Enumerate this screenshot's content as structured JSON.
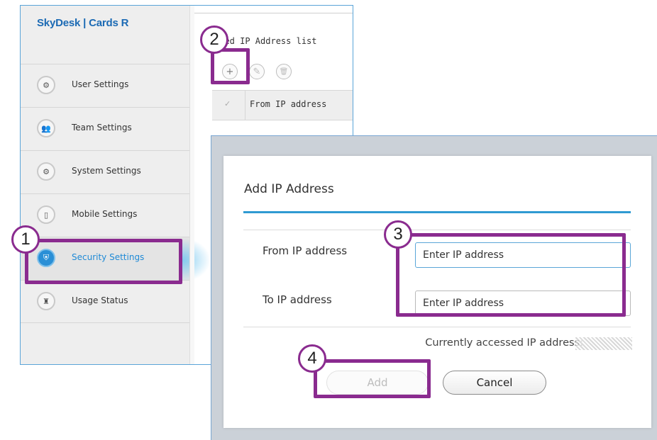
{
  "app": {
    "brand": "SkyDesk | Cards R",
    "sidebar": {
      "items": [
        {
          "label": "User Settings",
          "icon": "user-gear-icon"
        },
        {
          "label": "Team Settings",
          "icon": "team-icon"
        },
        {
          "label": "System Settings",
          "icon": "gear-icon"
        },
        {
          "label": "Mobile Settings",
          "icon": "mobile-icon"
        },
        {
          "label": "Security Settings",
          "icon": "shield-icon",
          "active": true
        },
        {
          "label": "Usage Status",
          "icon": "usage-icon"
        }
      ]
    },
    "main": {
      "list_title": "owed IP Address list",
      "toolbar": [
        {
          "icon": "add-icon",
          "glyph": "+"
        },
        {
          "icon": "edit-icon",
          "glyph": "✎"
        },
        {
          "icon": "delete-icon",
          "glyph": "🗑"
        }
      ],
      "table": {
        "check_glyph": "✓",
        "columns": [
          "From IP address"
        ]
      }
    }
  },
  "dialog": {
    "title": "Add IP Address",
    "from_label": "From IP address",
    "from_placeholder": "Enter IP address",
    "to_label": "To IP address",
    "to_placeholder": "Enter IP address",
    "current_ip_label": "Currently accessed IP address:",
    "add_label": "Add",
    "cancel_label": "Cancel"
  },
  "annotations": {
    "color": "#8a2b8f",
    "steps": [
      "1",
      "2",
      "3",
      "4"
    ]
  }
}
